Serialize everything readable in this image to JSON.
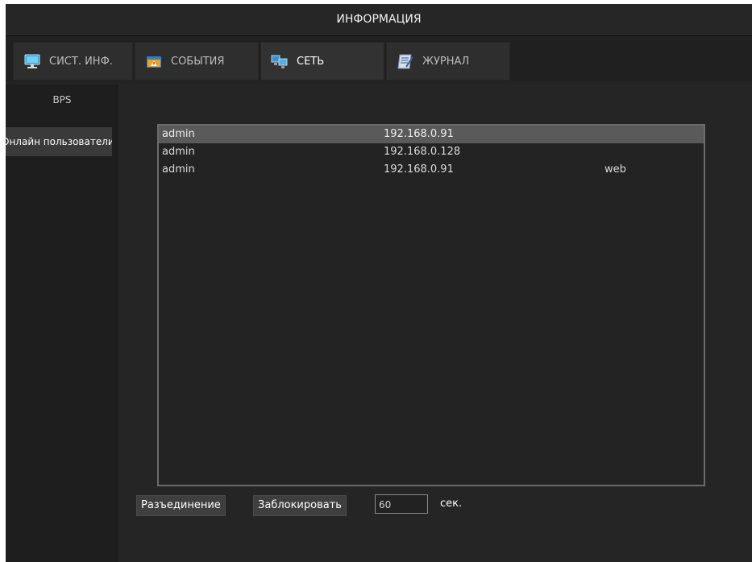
{
  "window": {
    "title": "ИНФОРМАЦИЯ"
  },
  "tabs": [
    {
      "label": "СИСТ. ИНФ.",
      "icon": "monitor-icon",
      "active": false
    },
    {
      "label": "СОБЫТИЯ",
      "icon": "warning-icon",
      "active": false
    },
    {
      "label": "СЕТЬ",
      "icon": "network-icon",
      "active": true
    },
    {
      "label": "ЖУРНАЛ",
      "icon": "log-icon",
      "active": false
    }
  ],
  "sidebar": {
    "items": [
      {
        "label": "BPS"
      },
      {
        "label": "Онлайн пользователи"
      }
    ]
  },
  "users_table": {
    "rows": [
      {
        "user": "admin",
        "ip": "192.168.0.91",
        "type": ""
      },
      {
        "user": "admin",
        "ip": "192.168.0.128",
        "type": ""
      },
      {
        "user": "admin",
        "ip": "192.168.0.91",
        "type": "web"
      }
    ]
  },
  "actions": {
    "disconnect_label": "Разъединение",
    "block_label": "Заблокировать",
    "block_seconds": "60",
    "seconds_unit": "сек."
  },
  "colors": {
    "background": "#232323",
    "selected_row": "#5a5a5a",
    "list_border": "#6b6b6b"
  }
}
